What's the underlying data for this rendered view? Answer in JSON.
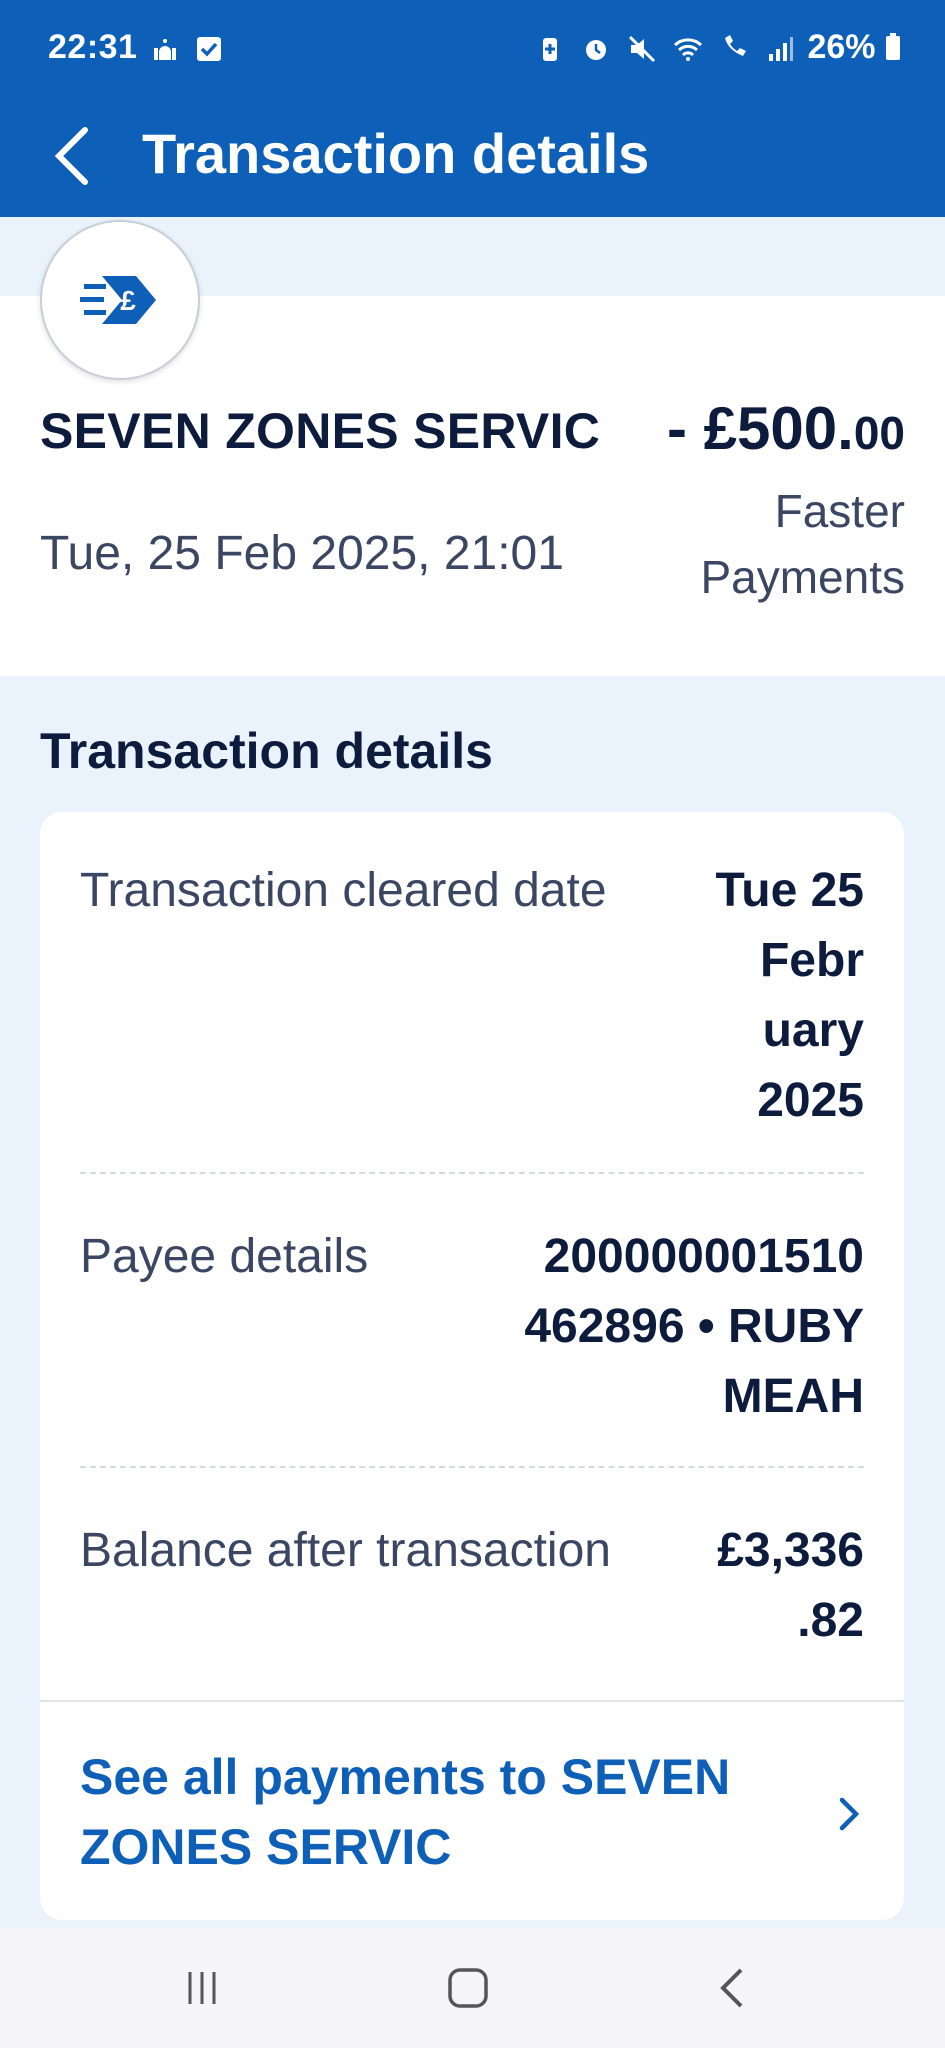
{
  "status_bar": {
    "time": "22:31",
    "battery": "26%",
    "left_icons": [
      "mosque-icon",
      "checkbox-icon"
    ],
    "right_icons": [
      "battery-saver-icon",
      "alarm-icon",
      "mute-icon",
      "wifi-icon",
      "wifi-call-icon",
      "signal-icon",
      "battery-icon"
    ]
  },
  "app_bar": {
    "title": "Transaction details",
    "back_icon": "chevron-left-icon"
  },
  "transaction": {
    "merchant": "SEVEN ZONES SERVIC",
    "amount_main": "- £500.",
    "amount_pence": "00",
    "datetime": "Tue, 25 Feb 2025, 21:01",
    "method": "Faster Payments",
    "logo_icon": "faster-payment-pound-icon"
  },
  "details": {
    "section_title": "Transaction details",
    "rows": [
      {
        "label": "Transaction cleared date",
        "value": "Tue 25 Febr uary 2025"
      },
      {
        "label": "Payee details",
        "value": "200000001510 462896 • RUBY MEAH"
      },
      {
        "label": "Balance after transaction",
        "value": "£3,336 .82"
      }
    ],
    "see_all": "See all payments to SEVEN ZONES SERVIC"
  },
  "colors": {
    "brand": "#0d5fb8",
    "background": "#eaf2fc",
    "text_dark": "#0d1b3d"
  },
  "nav_bar": {
    "icons": [
      "recents-icon",
      "home-icon",
      "back-icon"
    ]
  }
}
